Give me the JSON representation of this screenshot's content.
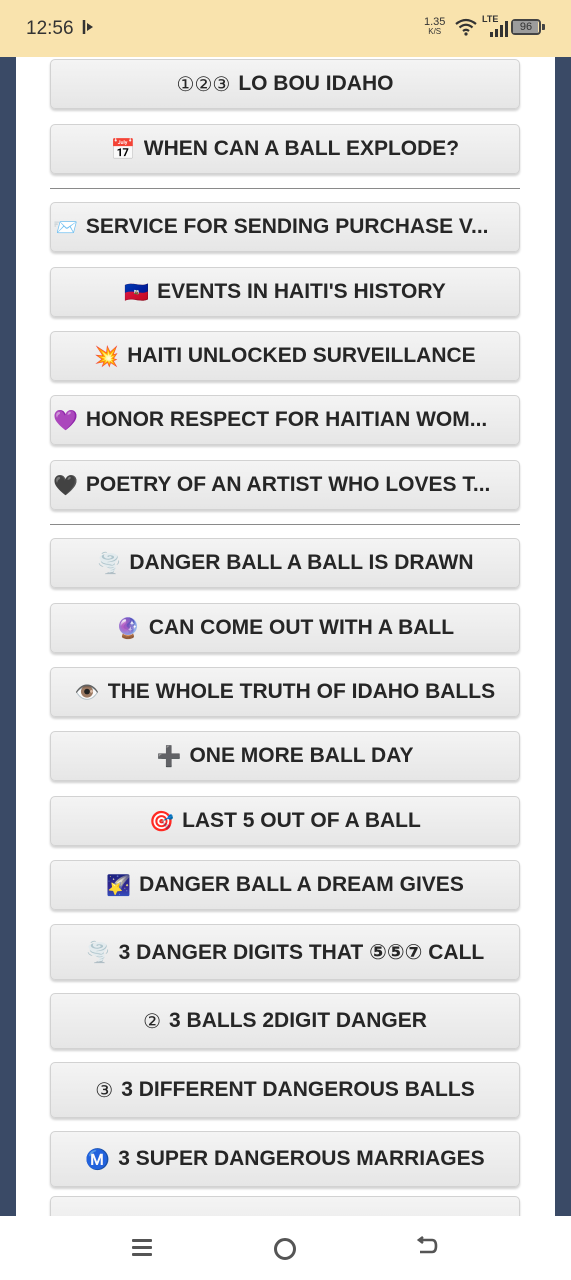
{
  "status_bar": {
    "time": "12:56",
    "net_speed_value": "1.35",
    "net_speed_unit": "K/S",
    "lte": "LTE",
    "battery": "96",
    "battery_level": 0.96,
    "background": "#f9e3ad"
  },
  "menu": {
    "group1": [
      {
        "icon": "①②③",
        "label": "LO BOU IDAHO"
      },
      {
        "icon": "📅",
        "label": "WHEN CAN A BALL EXPLODE?"
      }
    ],
    "group2": [
      {
        "icon": "📨",
        "label": "SERVICE FOR SENDING PURCHASE V..."
      },
      {
        "icon": "🇭🇹",
        "label": "EVENTS IN HAITI'S HISTORY"
      },
      {
        "icon": "💥",
        "label": "HAITI UNLOCKED SURVEILLANCE"
      },
      {
        "icon": "💜",
        "label": "HONOR RESPECT FOR HAITIAN WOM..."
      },
      {
        "icon": "🖤",
        "label": "POETRY OF AN ARTIST WHO LOVES T..."
      }
    ],
    "group3": [
      {
        "icon": "🌪️",
        "label": "DANGER BALL A BALL IS DRAWN"
      },
      {
        "icon": "🔮",
        "label": "CAN COME OUT WITH A BALL"
      },
      {
        "icon": "👁️",
        "label": "THE WHOLE TRUTH OF IDAHO BALLS"
      },
      {
        "icon": "➕",
        "label": "ONE MORE BALL DAY"
      },
      {
        "icon": "🎯",
        "label": "LAST 5 OUT OF A BALL"
      },
      {
        "icon": "🌠",
        "label": "DANGER BALL A DREAM GIVES"
      },
      {
        "icon": "🌪️",
        "label": "3 DANGER DIGITS THAT ⑤⑤⑦ CALL"
      },
      {
        "icon": "②",
        "label": "3 BALLS 2DIGIT DANGER"
      },
      {
        "icon": "③",
        "label": "3 DIFFERENT DANGEROUS BALLS"
      },
      {
        "icon": "Ⓜ️",
        "label": "3 SUPER DANGEROUS MARRIAGES"
      },
      {
        "icon": "",
        "label": ""
      }
    ]
  },
  "colors": {
    "button_bg": "#ececec",
    "button_text": "#262626",
    "divider": "#8a8a8a",
    "side_background": "#3a4a66"
  }
}
